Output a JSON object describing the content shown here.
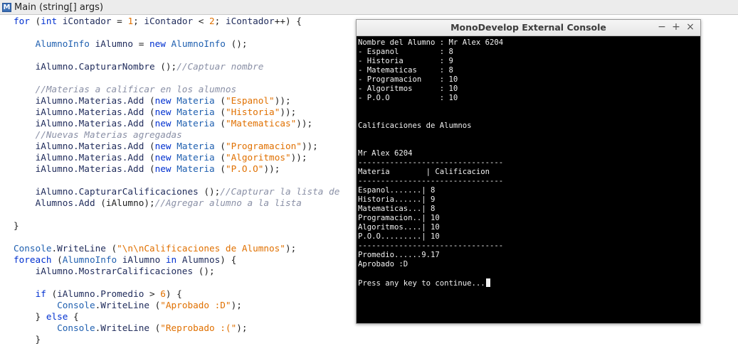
{
  "editor": {
    "method_title": "Main (string[] args)",
    "method_icon": "M"
  },
  "code_lines": [
    [
      {
        "t": "kw",
        "v": "for"
      },
      {
        "t": "op",
        "v": " ("
      },
      {
        "t": "kw",
        "v": "int"
      },
      {
        "t": "id",
        "v": " iContador"
      },
      {
        "t": "op",
        "v": " = "
      },
      {
        "t": "num",
        "v": "1"
      },
      {
        "t": "op",
        "v": "; "
      },
      {
        "t": "id",
        "v": "iContador"
      },
      {
        "t": "op",
        "v": " < "
      },
      {
        "t": "num",
        "v": "2"
      },
      {
        "t": "op",
        "v": "; "
      },
      {
        "t": "id",
        "v": "iContador"
      },
      {
        "t": "op",
        "v": "++) {"
      }
    ],
    [],
    [
      {
        "t": "op",
        "v": "    "
      },
      {
        "t": "ty",
        "v": "AlumnoInfo"
      },
      {
        "t": "id",
        "v": " iAlumno"
      },
      {
        "t": "op",
        "v": " = "
      },
      {
        "t": "kw",
        "v": "new"
      },
      {
        "t": "op",
        "v": " "
      },
      {
        "t": "ty",
        "v": "AlumnoInfo"
      },
      {
        "t": "op",
        "v": " ();"
      }
    ],
    [],
    [
      {
        "t": "op",
        "v": "    "
      },
      {
        "t": "id",
        "v": "iAlumno.CapturarNombre"
      },
      {
        "t": "op",
        "v": " ();"
      },
      {
        "t": "cm",
        "v": "//Captuar nombre"
      }
    ],
    [],
    [
      {
        "t": "op",
        "v": "    "
      },
      {
        "t": "cm",
        "v": "//Materias a calificar en los alumnos"
      }
    ],
    [
      {
        "t": "op",
        "v": "    "
      },
      {
        "t": "id",
        "v": "iAlumno.Materias.Add"
      },
      {
        "t": "op",
        "v": " ("
      },
      {
        "t": "kw",
        "v": "new"
      },
      {
        "t": "op",
        "v": " "
      },
      {
        "t": "ty",
        "v": "Materia"
      },
      {
        "t": "op",
        "v": " ("
      },
      {
        "t": "str",
        "v": "\"Espanol\""
      },
      {
        "t": "op",
        "v": "));"
      }
    ],
    [
      {
        "t": "op",
        "v": "    "
      },
      {
        "t": "id",
        "v": "iAlumno.Materias.Add"
      },
      {
        "t": "op",
        "v": " ("
      },
      {
        "t": "kw",
        "v": "new"
      },
      {
        "t": "op",
        "v": " "
      },
      {
        "t": "ty",
        "v": "Materia"
      },
      {
        "t": "op",
        "v": " ("
      },
      {
        "t": "str",
        "v": "\"Historia\""
      },
      {
        "t": "op",
        "v": "));"
      }
    ],
    [
      {
        "t": "op",
        "v": "    "
      },
      {
        "t": "id",
        "v": "iAlumno.Materias.Add"
      },
      {
        "t": "op",
        "v": " ("
      },
      {
        "t": "kw",
        "v": "new"
      },
      {
        "t": "op",
        "v": " "
      },
      {
        "t": "ty",
        "v": "Materia"
      },
      {
        "t": "op",
        "v": " ("
      },
      {
        "t": "str",
        "v": "\"Matematicas\""
      },
      {
        "t": "op",
        "v": "));"
      }
    ],
    [
      {
        "t": "op",
        "v": "    "
      },
      {
        "t": "cm",
        "v": "//Nuevas Materias agregadas"
      }
    ],
    [
      {
        "t": "op",
        "v": "    "
      },
      {
        "t": "id",
        "v": "iAlumno.Materias.Add"
      },
      {
        "t": "op",
        "v": " ("
      },
      {
        "t": "kw",
        "v": "new"
      },
      {
        "t": "op",
        "v": " "
      },
      {
        "t": "ty",
        "v": "Materia"
      },
      {
        "t": "op",
        "v": " ("
      },
      {
        "t": "str",
        "v": "\"Programacion\""
      },
      {
        "t": "op",
        "v": "));"
      }
    ],
    [
      {
        "t": "op",
        "v": "    "
      },
      {
        "t": "id",
        "v": "iAlumno.Materias.Add"
      },
      {
        "t": "op",
        "v": " ("
      },
      {
        "t": "kw",
        "v": "new"
      },
      {
        "t": "op",
        "v": " "
      },
      {
        "t": "ty",
        "v": "Materia"
      },
      {
        "t": "op",
        "v": " ("
      },
      {
        "t": "str",
        "v": "\"Algoritmos\""
      },
      {
        "t": "op",
        "v": "));"
      }
    ],
    [
      {
        "t": "op",
        "v": "    "
      },
      {
        "t": "id",
        "v": "iAlumno.Materias.Add"
      },
      {
        "t": "op",
        "v": " ("
      },
      {
        "t": "kw",
        "v": "new"
      },
      {
        "t": "op",
        "v": " "
      },
      {
        "t": "ty",
        "v": "Materia"
      },
      {
        "t": "op",
        "v": " ("
      },
      {
        "t": "str",
        "v": "\"P.O.O\""
      },
      {
        "t": "op",
        "v": "));"
      }
    ],
    [],
    [
      {
        "t": "op",
        "v": "    "
      },
      {
        "t": "id",
        "v": "iAlumno.CapturarCalificaciones"
      },
      {
        "t": "op",
        "v": " ();"
      },
      {
        "t": "cm",
        "v": "//Capturar la lista de"
      }
    ],
    [
      {
        "t": "op",
        "v": "    "
      },
      {
        "t": "id",
        "v": "Alumnos.Add"
      },
      {
        "t": "op",
        "v": " (iAlumno);"
      },
      {
        "t": "cm",
        "v": "//Agregar alumno a la lista"
      }
    ],
    [],
    [
      {
        "t": "op",
        "v": "}"
      }
    ],
    [],
    [
      {
        "t": "ty",
        "v": "Console"
      },
      {
        "t": "op",
        "v": "."
      },
      {
        "t": "id",
        "v": "WriteLine"
      },
      {
        "t": "op",
        "v": " ("
      },
      {
        "t": "str",
        "v": "\"\\n\\nCalificaciones de Alumnos\""
      },
      {
        "t": "op",
        "v": ");"
      }
    ],
    [
      {
        "t": "kw",
        "v": "foreach"
      },
      {
        "t": "op",
        "v": " ("
      },
      {
        "t": "ty",
        "v": "AlumnoInfo"
      },
      {
        "t": "id",
        "v": " iAlumno"
      },
      {
        "t": "op",
        "v": " "
      },
      {
        "t": "kw",
        "v": "in"
      },
      {
        "t": "id",
        "v": " Alumnos"
      },
      {
        "t": "op",
        "v": ") {"
      }
    ],
    [
      {
        "t": "op",
        "v": "    "
      },
      {
        "t": "id",
        "v": "iAlumno.MostrarCalificaciones"
      },
      {
        "t": "op",
        "v": " ();"
      }
    ],
    [],
    [
      {
        "t": "op",
        "v": "    "
      },
      {
        "t": "kw",
        "v": "if"
      },
      {
        "t": "op",
        "v": " ("
      },
      {
        "t": "id",
        "v": "iAlumno.Promedio"
      },
      {
        "t": "op",
        "v": " > "
      },
      {
        "t": "num",
        "v": "6"
      },
      {
        "t": "op",
        "v": ") {"
      }
    ],
    [
      {
        "t": "op",
        "v": "        "
      },
      {
        "t": "ty",
        "v": "Console"
      },
      {
        "t": "op",
        "v": "."
      },
      {
        "t": "id",
        "v": "WriteLine"
      },
      {
        "t": "op",
        "v": " ("
      },
      {
        "t": "str",
        "v": "\"Aprobado :D\""
      },
      {
        "t": "op",
        "v": ");"
      }
    ],
    [
      {
        "t": "op",
        "v": "    } "
      },
      {
        "t": "kw",
        "v": "else"
      },
      {
        "t": "op",
        "v": " {"
      }
    ],
    [
      {
        "t": "op",
        "v": "        "
      },
      {
        "t": "ty",
        "v": "Console"
      },
      {
        "t": "op",
        "v": "."
      },
      {
        "t": "id",
        "v": "WriteLine"
      },
      {
        "t": "op",
        "v": " ("
      },
      {
        "t": "str",
        "v": "\"Reprobado :(\""
      },
      {
        "t": "op",
        "v": ");"
      }
    ],
    [
      {
        "t": "op",
        "v": "    }"
      }
    ]
  ],
  "console": {
    "title": "MonoDevelop External Console",
    "controls": {
      "minimize": "−",
      "maximize": "+",
      "close": "×"
    },
    "lines": [
      "Nombre del Alumno : Mr Alex 6204",
      "- Espanol         : 8",
      "- Historia        : 9",
      "- Matematicas     : 8",
      "- Programacion    : 10",
      "- Algoritmos      : 10",
      "- P.O.O           : 10",
      "",
      "",
      "Calificaciones de Alumnos",
      "",
      "",
      "Mr Alex 6204",
      "--------------------------------",
      "Materia        | Calificacion",
      "--------------------------------",
      "Espanol.......| 8",
      "Historia......| 9",
      "Matematicas...| 8",
      "Programacion..| 10",
      "Algoritmos....| 10",
      "P.O.O.........| 10",
      "--------------------------------",
      "Promedio......9.17",
      "Aprobado :D",
      "",
      "Press any key to continue..."
    ]
  }
}
